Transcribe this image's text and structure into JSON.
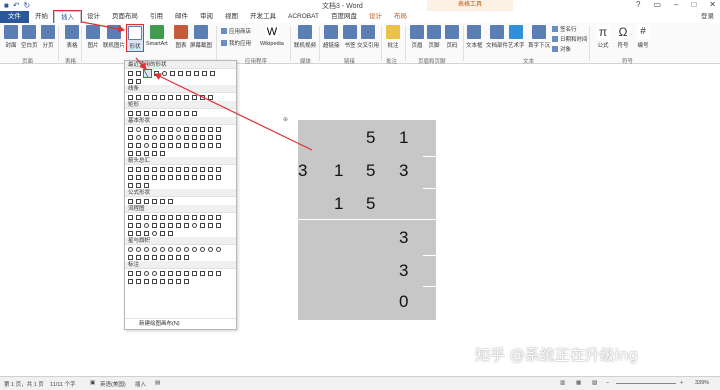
{
  "app": {
    "title": "文档3 - Word",
    "tools_title": "表格工具",
    "login": "登录"
  },
  "tabs": [
    "文件",
    "开始",
    "插入",
    "设计",
    "页面布局",
    "引用",
    "邮件",
    "审阅",
    "视图",
    "开发工具",
    "ACROBAT",
    "百度网盘",
    "设计",
    "布局"
  ],
  "ribbon": {
    "pages": {
      "cover": "封面",
      "blank": "空白页",
      "break": "分页"
    },
    "table": "表格",
    "illustrations": {
      "picture": "图片",
      "online_picture": "联机图片",
      "shapes": "形状",
      "smartart": "SmartArt",
      "chart": "图表",
      "screenshot": "屏幕截图"
    },
    "addins": {
      "store": "应用商店",
      "my_apps": "我的应用",
      "wikipedia": "Wikipedia"
    },
    "media": {
      "online_video": "联机视频"
    },
    "links": {
      "hyperlink": "超链接",
      "bookmark": "书签",
      "crossref": "交叉引用"
    },
    "comments": {
      "comment": "批注"
    },
    "header_footer": {
      "header": "页眉",
      "footer": "页脚",
      "page_number": "页码"
    },
    "text": {
      "textbox": "文本框",
      "quick_parts": "文档部件",
      "wordart": "艺术字",
      "dropcap": "首字下沉",
      "signature": "签名行",
      "datetime": "日期和时间",
      "object": "对象"
    },
    "symbols": {
      "equation": "公式",
      "symbol": "符号",
      "number": "编号"
    },
    "group_labels": {
      "pages": "页面",
      "table": "表格",
      "addins": "应用程序",
      "media": "媒体",
      "links": "链接",
      "comments": "批注",
      "header_footer": "页眉和页脚",
      "text": "文本",
      "symbols": "符号"
    }
  },
  "shapes_menu": {
    "sections": [
      "最近使用的形状",
      "线条",
      "矩形",
      "基本形状",
      "箭头总汇",
      "公式形状",
      "流程图",
      "星与旗帜",
      "标注"
    ],
    "new_canvas": "新建绘图画布(N)"
  },
  "table_cells": [
    {
      "row": 0,
      "col": 2,
      "v": "5"
    },
    {
      "row": 0,
      "col": 3,
      "v": "1"
    },
    {
      "row": 1,
      "col": 0,
      "v": "3"
    },
    {
      "row": 1,
      "col": 1,
      "v": "1"
    },
    {
      "row": 1,
      "col": 2,
      "v": "5"
    },
    {
      "row": 1,
      "col": 3,
      "v": "3"
    },
    {
      "row": 2,
      "col": 1,
      "v": "1"
    },
    {
      "row": 2,
      "col": 2,
      "v": "5"
    },
    {
      "row": 3,
      "col": 3,
      "v": "3"
    },
    {
      "row": 4,
      "col": 3,
      "v": "3"
    },
    {
      "row": 5,
      "col": 3,
      "v": "0"
    }
  ],
  "status": {
    "page": "第 1 页，共 1 页",
    "words": "11/11 个字",
    "lang": "英语(美国)",
    "mode": "插入",
    "zoom": "339%"
  },
  "watermark": "知乎 @系统正在升级ing",
  "colors": {
    "accent": "#2b579a",
    "highlight": "#e03030",
    "table_fill": "#c7c7c7"
  }
}
